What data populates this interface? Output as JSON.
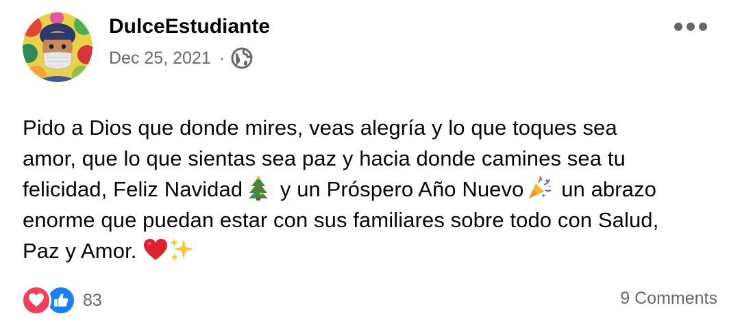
{
  "post": {
    "author": "DulceEstudiante",
    "date": "Dec 25, 2021",
    "separator": "·",
    "privacy_icon": "globe-icon",
    "more_icon": "more-options-icon",
    "body_lines": [
      "Pido a Dios que donde mires, veas alegría y lo que toques sea",
      "amor, que lo que sientas sea paz y hacia donde camines sea tu",
      "felicidad, Feliz Navidad",
      "y un Próspero Año Nuevo",
      "un abrazo",
      "enorme que puedan estar con sus familiares sobre todo con Salud,",
      "Paz y Amor."
    ],
    "emojis": [
      "christmas-tree-emoji",
      "party-popper-emoji",
      "red-heart-emoji",
      "sparkles-emoji"
    ]
  },
  "footer": {
    "reaction_icons": [
      "love-reaction-icon",
      "like-reaction-icon"
    ],
    "reaction_count": "83",
    "comments": "9 Comments"
  },
  "colors": {
    "text": "#050505",
    "secondary_text": "#65676b",
    "love": "#f33e58",
    "like": "#1a7ef5"
  }
}
